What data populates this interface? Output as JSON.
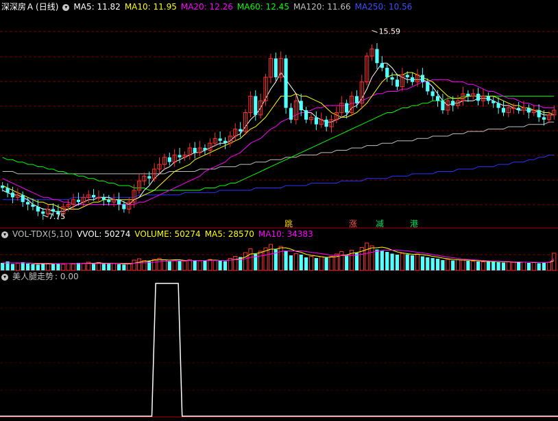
{
  "price_panel": {
    "stock_name": "深深房Ａ",
    "period": "(日线)",
    "ma5": "MA5: 11.82",
    "ma10": "MA10: 11.95",
    "ma20": "MA20: 12.26",
    "ma60": "MA60: 12.45",
    "ma120": "MA120: 11.66",
    "ma250": "MA250: 10.56",
    "high_label": "15.59",
    "low_label": "7.75",
    "tags": [
      {
        "text": "跳",
        "color": "#ffd200"
      },
      {
        "text": "涨",
        "color": "#ff5050"
      },
      {
        "text": "减",
        "color": "#00e060"
      },
      {
        "text": "港",
        "color": "#00e060"
      }
    ]
  },
  "volume_panel": {
    "indicator": "VOL-TDX(5,10)",
    "vvol": "VVOL: 50274",
    "volume": "VOLUME: 50274",
    "ma5": "MA5: 28570",
    "ma10": "MA10: 34383"
  },
  "signal_panel": {
    "name": "美人腿走势",
    "value": ": 0.00"
  },
  "colors": {
    "up": "#ff3232",
    "down": "#54ffff",
    "ma5": "#ffffff",
    "ma10": "#ffff00",
    "ma20": "#ff00ff",
    "ma60": "#00ff00",
    "ma120": "#c0c0c0",
    "ma250": "#3030ff",
    "grid": "#7a0000"
  },
  "chart_data": [
    {
      "type": "candlestick",
      "title": "深深房Ａ (日线)",
      "ylim": [
        7.2,
        16.3
      ],
      "max_marker": 15.59,
      "min_marker": 7.75,
      "close": [
        8.9,
        8.7,
        8.5,
        8.6,
        8.3,
        8.2,
        8.1,
        7.9,
        7.8,
        8.0,
        7.9,
        7.8,
        8.1,
        8.2,
        8.4,
        8.3,
        8.5,
        8.6,
        8.5,
        8.5,
        8.4,
        8.3,
        8.4,
        8.2,
        8.0,
        8.3,
        8.8,
        9.2,
        9.4,
        9.3,
        9.7,
        9.9,
        10.2,
        10.0,
        10.3,
        10.2,
        10.3,
        10.6,
        10.4,
        10.6,
        10.5,
        10.8,
        11.0,
        10.9,
        10.8,
        11.1,
        11.4,
        11.3,
        12.1,
        12.8,
        12.0,
        12.6,
        13.6,
        14.4,
        13.6,
        14.4,
        12.3,
        11.8,
        12.6,
        12.2,
        11.8,
        11.9,
        11.6,
        11.8,
        11.5,
        11.8,
        12.1,
        12.5,
        12.1,
        12.8,
        12.5,
        13.4,
        14.5,
        14.8,
        14.2,
        14.0,
        13.6,
        13.5,
        13.2,
        13.7,
        13.6,
        13.4,
        13.7,
        13.4,
        13.0,
        12.8,
        12.6,
        12.2,
        12.6,
        12.4,
        12.6,
        12.9,
        12.8,
        12.9,
        12.6,
        12.8,
        12.6,
        12.5,
        12.3,
        12.1,
        12.3,
        12.3,
        12.2,
        12.3,
        12.1,
        12.2,
        11.9,
        11.8,
        12.0,
        12.2
      ],
      "ma5": [
        8.8,
        8.7,
        8.6,
        8.6,
        8.5,
        8.4,
        8.2,
        8.1,
        8.0,
        8.0,
        7.9,
        7.9,
        7.9,
        8.0,
        8.1,
        8.2,
        8.3,
        8.4,
        8.4,
        8.5,
        8.5,
        8.5,
        8.4,
        8.4,
        8.3,
        8.2,
        8.4,
        8.5,
        8.8,
        9.0,
        9.3,
        9.5,
        9.7,
        9.8,
        10.0,
        10.1,
        10.2,
        10.3,
        10.4,
        10.4,
        10.5,
        10.6,
        10.7,
        10.8,
        10.8,
        10.9,
        11.1,
        11.2,
        11.5,
        11.8,
        12.0,
        12.3,
        12.7,
        13.1,
        13.4,
        13.8,
        13.5,
        13.2,
        12.9,
        12.3,
        12.1,
        12.1,
        11.9,
        11.8,
        11.7,
        11.7,
        11.8,
        11.9,
        12.0,
        12.3,
        12.4,
        12.7,
        13.1,
        13.6,
        13.9,
        14.2,
        14.2,
        14.0,
        13.7,
        13.6,
        13.5,
        13.5,
        13.5,
        13.5,
        13.4,
        13.2,
        12.9,
        12.6,
        12.4,
        12.5,
        12.5,
        12.6,
        12.6,
        12.6,
        12.7,
        12.7,
        12.7,
        12.6,
        12.5,
        12.4,
        12.4,
        12.3,
        12.2,
        12.2,
        12.2,
        12.2,
        12.1,
        12.0,
        12.0,
        12.0
      ],
      "ma10": [
        9.0,
        8.9,
        8.8,
        8.7,
        8.6,
        8.5,
        8.4,
        8.3,
        8.3,
        8.2,
        8.2,
        8.1,
        8.0,
        8.0,
        8.0,
        8.0,
        8.1,
        8.2,
        8.3,
        8.3,
        8.4,
        8.4,
        8.4,
        8.4,
        8.4,
        8.4,
        8.4,
        8.5,
        8.6,
        8.7,
        8.8,
        9.0,
        9.2,
        9.4,
        9.6,
        9.7,
        9.8,
        9.9,
        10.1,
        10.2,
        10.3,
        10.4,
        10.5,
        10.6,
        10.7,
        10.8,
        10.9,
        11.0,
        11.2,
        11.4,
        11.5,
        11.7,
        11.9,
        12.2,
        12.5,
        12.8,
        12.8,
        12.8,
        12.9,
        12.8,
        12.8,
        12.7,
        12.6,
        12.5,
        12.3,
        12.1,
        12.0,
        11.9,
        11.9,
        12.0,
        12.1,
        12.3,
        12.5,
        12.8,
        13.1,
        13.4,
        13.6,
        13.7,
        13.7,
        13.7,
        13.8,
        13.8,
        13.7,
        13.6,
        13.5,
        13.4,
        13.2,
        13.0,
        12.8,
        12.7,
        12.7,
        12.7,
        12.8,
        12.8,
        12.8,
        12.8,
        12.8,
        12.8,
        12.7,
        12.6,
        12.5,
        12.4,
        12.4,
        12.3,
        12.3,
        12.2,
        12.2,
        12.1,
        12.1,
        12.0
      ],
      "ma20": [
        9.3,
        9.2,
        9.1,
        9.0,
        8.9,
        8.8,
        8.7,
        8.6,
        8.5,
        8.5,
        8.4,
        8.4,
        8.3,
        8.3,
        8.2,
        8.2,
        8.2,
        8.2,
        8.2,
        8.2,
        8.2,
        8.2,
        8.2,
        8.2,
        8.2,
        8.2,
        8.2,
        8.3,
        8.3,
        8.4,
        8.5,
        8.6,
        8.7,
        8.8,
        8.9,
        9.0,
        9.1,
        9.2,
        9.3,
        9.4,
        9.6,
        9.7,
        9.8,
        9.9,
        10.0,
        10.2,
        10.3,
        10.4,
        10.6,
        10.8,
        10.9,
        11.0,
        11.2,
        11.4,
        11.5,
        11.7,
        11.8,
        11.9,
        12.0,
        12.1,
        12.1,
        12.2,
        12.3,
        12.3,
        12.4,
        12.4,
        12.4,
        12.4,
        12.4,
        12.5,
        12.5,
        12.6,
        12.7,
        12.8,
        12.9,
        12.9,
        13.0,
        13.0,
        13.0,
        13.1,
        13.1,
        13.2,
        13.3,
        13.4,
        13.4,
        13.5,
        13.5,
        13.5,
        13.5,
        13.4,
        13.4,
        13.4,
        13.3,
        13.3,
        13.2,
        13.1,
        13.0,
        13.0,
        12.9,
        12.8,
        12.7,
        12.7,
        12.6,
        12.5,
        12.5,
        12.4,
        12.4,
        12.3,
        12.3,
        12.3
      ],
      "ma60": [
        10.2,
        10.1,
        10.1,
        10.0,
        10.0,
        9.9,
        9.9,
        9.8,
        9.8,
        9.7,
        9.7,
        9.6,
        9.6,
        9.5,
        9.5,
        9.4,
        9.4,
        9.3,
        9.3,
        9.2,
        9.2,
        9.1,
        9.1,
        9.0,
        9.0,
        9.0,
        8.9,
        8.9,
        8.9,
        8.8,
        8.8,
        8.8,
        8.8,
        8.8,
        8.8,
        8.8,
        8.8,
        8.8,
        8.8,
        8.8,
        8.9,
        8.9,
        8.9,
        9.0,
        9.0,
        9.1,
        9.1,
        9.2,
        9.3,
        9.4,
        9.5,
        9.6,
        9.7,
        9.8,
        9.9,
        10.0,
        10.1,
        10.2,
        10.3,
        10.4,
        10.5,
        10.6,
        10.7,
        10.8,
        10.9,
        11.0,
        11.1,
        11.2,
        11.3,
        11.4,
        11.5,
        11.6,
        11.7,
        11.8,
        11.9,
        12.0,
        12.1,
        12.1,
        12.2,
        12.3,
        12.3,
        12.4,
        12.4,
        12.5,
        12.5,
        12.6,
        12.6,
        12.6,
        12.7,
        12.7,
        12.7,
        12.8,
        12.8,
        12.8,
        12.8,
        12.8,
        12.8,
        12.8,
        12.8,
        12.8,
        12.8,
        12.8,
        12.8,
        12.8,
        12.8,
        12.8,
        12.8,
        12.8,
        12.8,
        12.8
      ],
      "ma120": [
        9.6,
        9.6,
        9.6,
        9.5,
        9.5,
        9.5,
        9.5,
        9.5,
        9.5,
        9.5,
        9.5,
        9.5,
        9.5,
        9.5,
        9.5,
        9.5,
        9.5,
        9.5,
        9.5,
        9.5,
        9.5,
        9.5,
        9.5,
        9.5,
        9.5,
        9.5,
        9.5,
        9.5,
        9.5,
        9.5,
        9.5,
        9.5,
        9.5,
        9.6,
        9.6,
        9.6,
        9.6,
        9.6,
        9.6,
        9.7,
        9.7,
        9.7,
        9.7,
        9.8,
        9.8,
        9.8,
        9.8,
        9.9,
        9.9,
        9.9,
        10.0,
        10.0,
        10.0,
        10.1,
        10.1,
        10.1,
        10.2,
        10.2,
        10.2,
        10.3,
        10.3,
        10.3,
        10.3,
        10.4,
        10.4,
        10.4,
        10.5,
        10.5,
        10.5,
        10.6,
        10.6,
        10.6,
        10.7,
        10.7,
        10.7,
        10.8,
        10.8,
        10.8,
        10.9,
        10.9,
        10.9,
        10.9,
        11.0,
        11.0,
        11.0,
        11.1,
        11.1,
        11.1,
        11.1,
        11.2,
        11.2,
        11.2,
        11.3,
        11.3,
        11.3,
        11.3,
        11.4,
        11.4,
        11.4,
        11.4,
        11.5,
        11.5,
        11.5,
        11.5,
        11.6,
        11.6,
        11.6,
        11.6,
        11.7,
        11.7
      ],
      "ma250": [
        8.4,
        8.4,
        8.4,
        8.4,
        8.4,
        8.4,
        8.4,
        8.4,
        8.4,
        8.4,
        8.4,
        8.4,
        8.4,
        8.4,
        8.5,
        8.5,
        8.5,
        8.5,
        8.5,
        8.5,
        8.5,
        8.5,
        8.5,
        8.5,
        8.5,
        8.5,
        8.5,
        8.6,
        8.6,
        8.6,
        8.6,
        8.6,
        8.6,
        8.6,
        8.6,
        8.6,
        8.7,
        8.7,
        8.7,
        8.7,
        8.7,
        8.7,
        8.7,
        8.8,
        8.8,
        8.8,
        8.8,
        8.8,
        8.8,
        8.8,
        8.9,
        8.9,
        8.9,
        8.9,
        8.9,
        8.9,
        9.0,
        9.0,
        9.0,
        9.0,
        9.0,
        9.1,
        9.1,
        9.1,
        9.1,
        9.1,
        9.1,
        9.2,
        9.2,
        9.2,
        9.2,
        9.2,
        9.3,
        9.3,
        9.3,
        9.3,
        9.3,
        9.4,
        9.4,
        9.4,
        9.4,
        9.5,
        9.5,
        9.5,
        9.5,
        9.5,
        9.6,
        9.6,
        9.6,
        9.6,
        9.7,
        9.7,
        9.7,
        9.7,
        9.8,
        9.8,
        9.8,
        9.8,
        9.9,
        9.9,
        9.9,
        10.0,
        10.0,
        10.0,
        10.1,
        10.1,
        10.2,
        10.2,
        10.3,
        10.3
      ]
    },
    {
      "type": "bar",
      "title": "VOL-TDX(5,10)",
      "ylim": [
        0,
        90000
      ],
      "values": [
        22000,
        26000,
        19000,
        21000,
        24000,
        20000,
        18000,
        17000,
        22000,
        20000,
        19000,
        21000,
        18000,
        20000,
        19000,
        22000,
        21000,
        24000,
        20000,
        23000,
        19000,
        21000,
        20000,
        18000,
        17000,
        20000,
        30000,
        34000,
        29000,
        27000,
        32000,
        35000,
        31000,
        28000,
        30000,
        29000,
        27000,
        31000,
        30000,
        28000,
        29000,
        32000,
        30000,
        28000,
        27000,
        35000,
        41000,
        39000,
        52000,
        63000,
        48000,
        56000,
        66000,
        76000,
        61000,
        70000,
        58000,
        44000,
        49000,
        46000,
        38000,
        41000,
        36000,
        40000,
        37000,
        41000,
        48000,
        55000,
        46000,
        59000,
        51000,
        67000,
        80000,
        72000,
        61000,
        58000,
        54000,
        49000,
        46000,
        50000,
        47000,
        44000,
        48000,
        41000,
        38000,
        36000,
        34000,
        30000,
        32000,
        29000,
        31000,
        30000,
        28000,
        27000,
        26000,
        25000,
        27000,
        26000,
        24000,
        23000,
        25000,
        24000,
        23000,
        24000,
        22000,
        23000,
        21000,
        22000,
        24000,
        50274
      ],
      "ma5": [
        21000,
        22000,
        22000,
        22000,
        22000,
        22000,
        20000,
        19000,
        20000,
        19000,
        19000,
        20000,
        20000,
        20000,
        19000,
        20000,
        20000,
        21000,
        21000,
        22000,
        21000,
        21000,
        21000,
        20000,
        19000,
        19000,
        21000,
        24000,
        26000,
        28000,
        30000,
        31000,
        31000,
        30000,
        31000,
        31000,
        29000,
        29000,
        29000,
        29000,
        29000,
        30000,
        30000,
        29000,
        29000,
        30000,
        32000,
        34000,
        39000,
        48000,
        49000,
        52000,
        57000,
        62000,
        62000,
        66000,
        66000,
        62000,
        56000,
        53000,
        47000,
        44000,
        42000,
        40000,
        38000,
        39000,
        40000,
        44000,
        45000,
        50000,
        52000,
        56000,
        61000,
        66000,
        66000,
        68000,
        65000,
        59000,
        54000,
        51000,
        49000,
        47000,
        47000,
        46000,
        44000,
        41000,
        39000,
        36000,
        34000,
        32000,
        31000,
        30000,
        30000,
        29000,
        28000,
        27000,
        26000,
        26000,
        26000,
        25000,
        25000,
        24000,
        24000,
        24000,
        24000,
        23000,
        23000,
        23000,
        23000,
        28570
      ],
      "ma10": [
        22000,
        22000,
        22000,
        22000,
        22000,
        22000,
        21000,
        21000,
        21000,
        21000,
        20000,
        20000,
        20000,
        20000,
        20000,
        20000,
        20000,
        20000,
        20000,
        20000,
        20000,
        20000,
        21000,
        21000,
        21000,
        21000,
        21000,
        22000,
        22000,
        23000,
        24000,
        26000,
        27000,
        27000,
        28000,
        28000,
        28000,
        29000,
        29000,
        29000,
        29000,
        29000,
        29000,
        29000,
        29000,
        30000,
        31000,
        32000,
        34000,
        38000,
        40000,
        42000,
        45000,
        48000,
        51000,
        55000,
        57000,
        57000,
        57000,
        57000,
        55000,
        53000,
        51000,
        49000,
        47000,
        44000,
        43000,
        43000,
        43000,
        44000,
        45000,
        47000,
        50000,
        53000,
        56000,
        58000,
        59000,
        59000,
        59000,
        58000,
        57000,
        55000,
        53000,
        51000,
        49000,
        46000,
        44000,
        41000,
        39000,
        37000,
        35000,
        33000,
        32000,
        31000,
        30000,
        29000,
        28000,
        27000,
        27000,
        26000,
        26000,
        25000,
        25000,
        24000,
        24000,
        24000,
        23000,
        23000,
        23000,
        34383
      ]
    },
    {
      "type": "line",
      "title": "美人腿走势",
      "ylim": [
        0,
        1
      ],
      "values": [
        0,
        0,
        0,
        0,
        0,
        0,
        0,
        0,
        0,
        0,
        0,
        0,
        0,
        0,
        0,
        0,
        0,
        0,
        0,
        0,
        0,
        0,
        0,
        0,
        0,
        0,
        0,
        0,
        0,
        0,
        0,
        0,
        0,
        0,
        0,
        0,
        0,
        0,
        0,
        0,
        0,
        0,
        0,
        0,
        0,
        0,
        0,
        0,
        0,
        0,
        0,
        0,
        0,
        0,
        0,
        0,
        0,
        0,
        0,
        0,
        0,
        0,
        0,
        0,
        0,
        0,
        0,
        0,
        0,
        0,
        0,
        0,
        0,
        0,
        0,
        0,
        0,
        0,
        0,
        0,
        0,
        0,
        0,
        0,
        0,
        0,
        0,
        0,
        0,
        0,
        0,
        0,
        0,
        0,
        0,
        0,
        0,
        0,
        0,
        0,
        0,
        0,
        0,
        0,
        0,
        0,
        0,
        0,
        0,
        0
      ],
      "pulse_index_range": [
        30,
        35
      ]
    }
  ]
}
